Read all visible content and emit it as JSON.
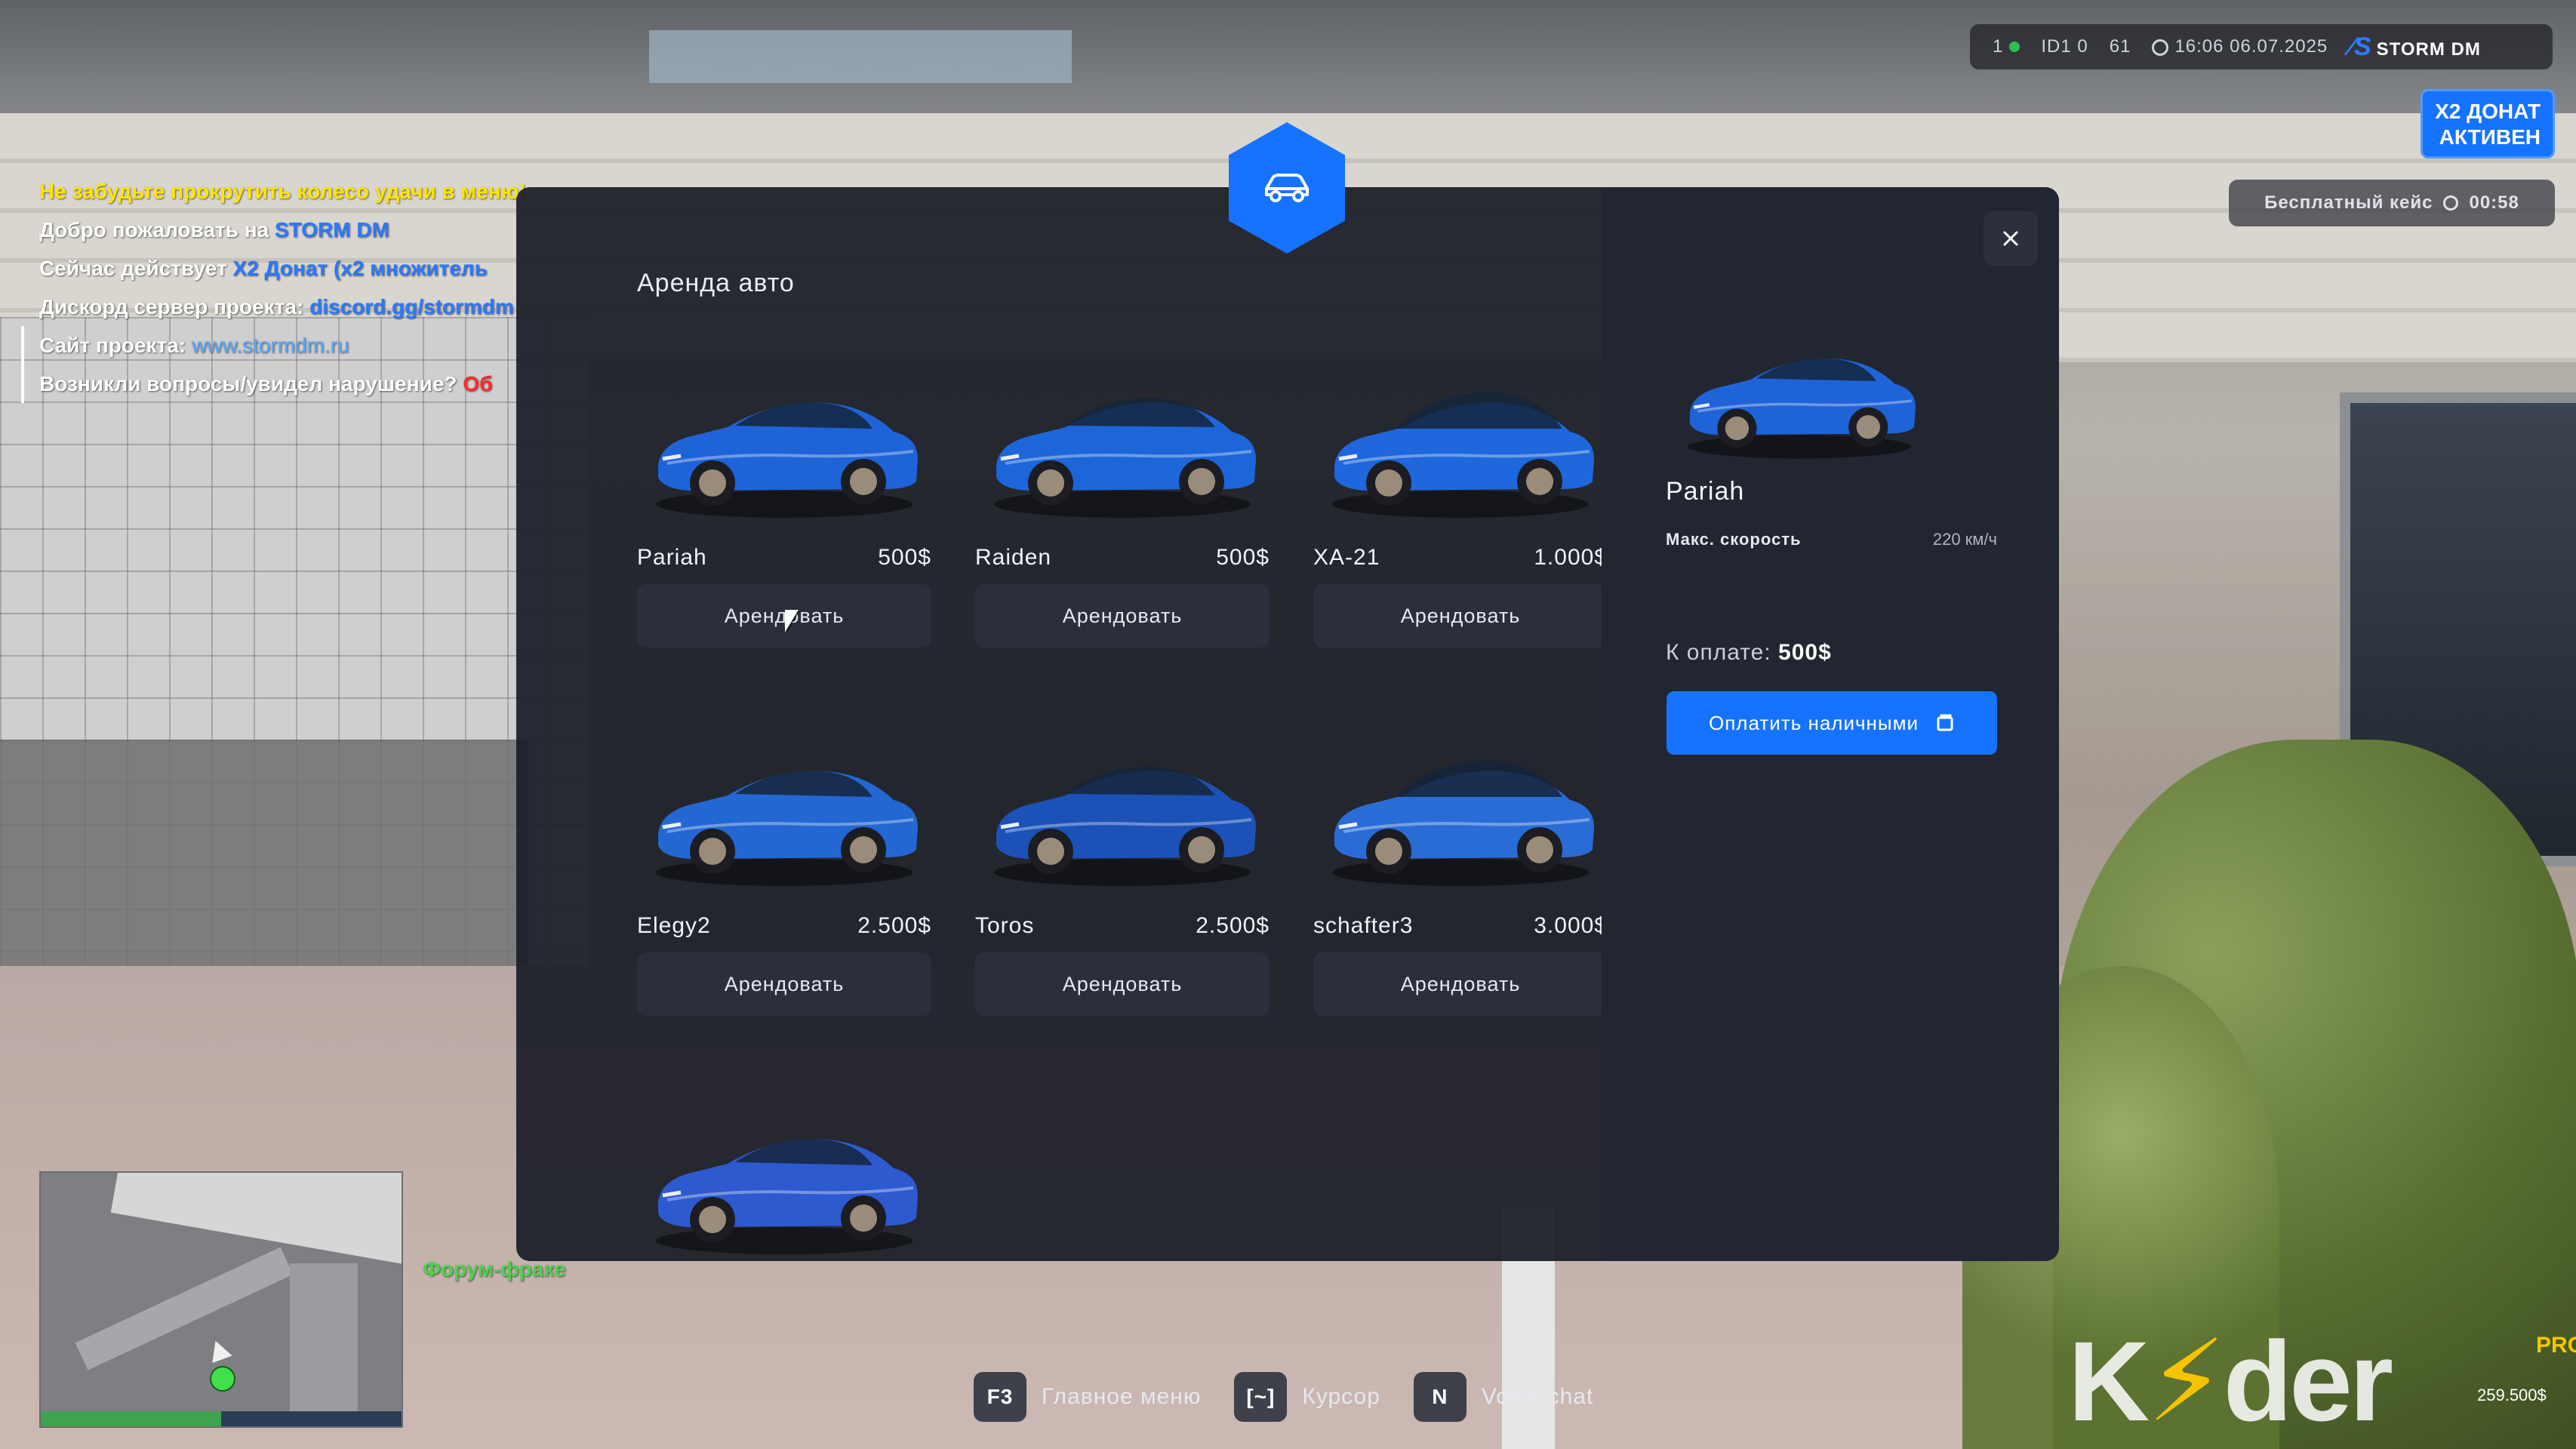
{
  "hud": {
    "players_online": "1",
    "id_label": "ID1 0",
    "ping": "61",
    "datetime": "16:06 06.07.2025",
    "brand": "STORM DM"
  },
  "donate_banner": {
    "line1": "X2 ДОНАТ",
    "line2": "АКТИВЕН"
  },
  "free_case": {
    "label": "Бесплатный кейс",
    "timer": "00:58"
  },
  "chat": {
    "line1": "Не забудьте прокрутить колесо удачи в меню!",
    "line2_prefix": "Добро пожаловать на ",
    "line2_highlight": "STORM DM",
    "line3_prefix": "Сейчас действует ",
    "line3_highlight": "X2 Донат (x2 множитель",
    "line4_prefix": "Дискорд сервер проекта: ",
    "line4_highlight": "discord.gg/stormdm",
    "line5_prefix": "Сайт проекта: ",
    "line5_highlight": "www.stormdm.ru",
    "line6_prefix": "Возникли вопросы/увидел нарушение? ",
    "line6_highlight": "Об"
  },
  "modal": {
    "title": "Аренда авто",
    "rent_label": "Арендовать",
    "cars": [
      {
        "name": "Pariah",
        "price": "500$",
        "color": "#1f63d8"
      },
      {
        "name": "Raiden",
        "price": "500$",
        "color": "#1d66d9"
      },
      {
        "name": "XA-21",
        "price": "1.000$",
        "color": "#1e67dc"
      },
      {
        "name": "Elegy2",
        "price": "2.500$",
        "color": "#2367d2"
      },
      {
        "name": "Toros",
        "price": "2.500$",
        "color": "#1c52b8"
      },
      {
        "name": "schafter3",
        "price": "3.000$",
        "color": "#2a6cd6"
      },
      {
        "name": "",
        "price": "",
        "color": "#2e5ad0"
      }
    ],
    "selected": {
      "name": "Pariah",
      "max_speed_label": "Макс. скорость",
      "max_speed_value": "220 км/ч",
      "pay_label": "К оплате:",
      "pay_value": "500$",
      "pay_button": "Оплатить наличными"
    }
  },
  "minimap": {
    "health_pct": 50
  },
  "forum_text": "Форум-фраке",
  "hints": [
    {
      "key": "F3",
      "label": "Главное меню"
    },
    {
      "key": "[~]",
      "label": "Курсор"
    },
    {
      "key": "N",
      "label": "Voice chat"
    }
  ],
  "watermark": {
    "text_a": "K",
    "text_bolt": "⚡",
    "text_b": "der",
    "badge": "PRO",
    "number": "259.500$"
  },
  "colors": {
    "accent": "#1673ff",
    "panel": "#1a1d26",
    "button": "#2a2f3b"
  }
}
